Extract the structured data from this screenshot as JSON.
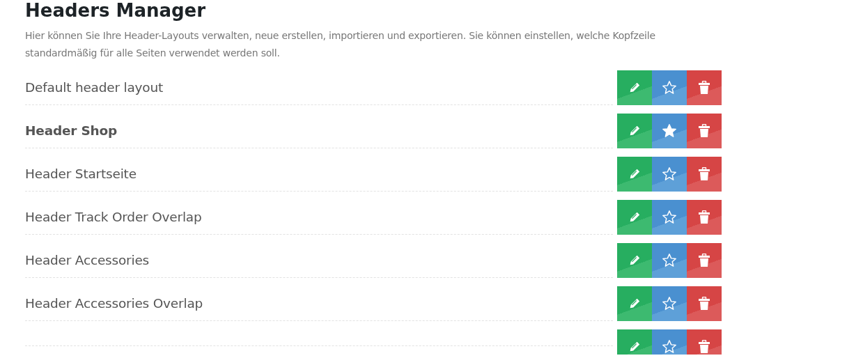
{
  "title": "Headers Manager",
  "description": "Hier können Sie Ihre Header-Layouts verwalten, neue erstellen, importieren und exportieren. Sie können einstellen, welche Kopfzeile standardmäßig für alle Seiten verwendet werden soll.",
  "headers": [
    {
      "label": "Default header layout",
      "selected": false
    },
    {
      "label": "Header Shop",
      "selected": true
    },
    {
      "label": "Header Startseite",
      "selected": false
    },
    {
      "label": "Header Track Order Overlap",
      "selected": false
    },
    {
      "label": "Header Accessories",
      "selected": false
    },
    {
      "label": "Header Accessories Overlap",
      "selected": false
    },
    {
      "selected": false
    }
  ]
}
